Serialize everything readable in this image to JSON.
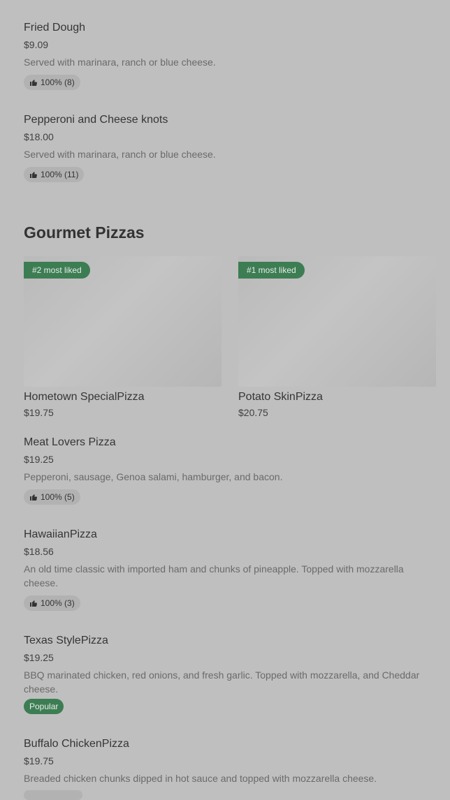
{
  "items_top": [
    {
      "name": "Fried Dough",
      "price": "$9.09",
      "desc": "Served with marinara, ranch or blue cheese.",
      "rating": "100% (8)"
    },
    {
      "name": "Pepperoni and Cheese knots",
      "price": "$18.00",
      "desc": "Served with marinara, ranch or blue cheese.",
      "rating": "100% (11)"
    }
  ],
  "section": {
    "title": "Gourmet Pizzas"
  },
  "cards": [
    {
      "badge": "#2 most liked",
      "name": "Hometown SpecialPizza",
      "price": "$19.75"
    },
    {
      "badge": "#1 most liked",
      "name": "Potato SkinPizza",
      "price": "$20.75"
    }
  ],
  "items_bottom": [
    {
      "name": "Meat Lovers Pizza",
      "price": "$19.25",
      "desc": "Pepperoni, sausage, Genoa salami, hamburger, and bacon.",
      "rating": "100% (5)"
    },
    {
      "name": "HawaiianPizza",
      "price": "$18.56",
      "desc": "An old time classic with imported ham and chunks of pineapple. Topped with mozzarella cheese.",
      "rating": "100% (3)"
    },
    {
      "name": "Texas StylePizza",
      "price": "$19.25",
      "desc": "BBQ marinated chicken, red onions, and fresh garlic. Topped with mozzarella, and Cheddar cheese.",
      "badge": "Popular"
    },
    {
      "name": "Buffalo ChickenPizza",
      "price": "$19.75",
      "desc": "Breaded chicken chunks dipped in hot sauce and topped with mozzarella cheese."
    }
  ],
  "icons": {
    "thumbs_up": "thumbs-up-icon"
  },
  "colors": {
    "background": "#bfbfbf",
    "accent_green": "#3d7d53",
    "pill_bg": "#b2b2b2"
  }
}
